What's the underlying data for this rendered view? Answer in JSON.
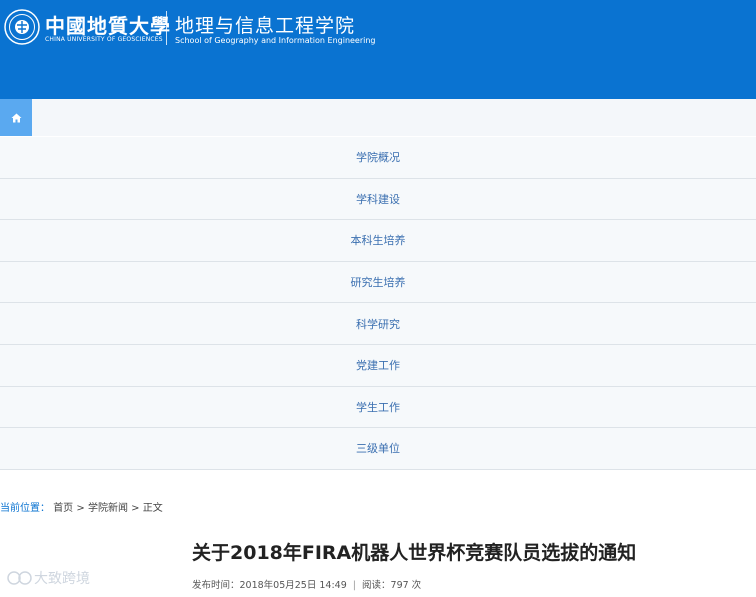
{
  "header": {
    "university_cn": "中國地質大學",
    "university_en": "CHINA UNIVERSITY OF GEOSCIENCES",
    "school_cn": "地理与信息工程学院",
    "school_en": "School of Geography and Information Engineering",
    "bg_color": "#0a73d1"
  },
  "home": {
    "icon": "home-icon"
  },
  "nav": {
    "items": [
      {
        "label": "学院概况"
      },
      {
        "label": "学科建设"
      },
      {
        "label": "本科生培养"
      },
      {
        "label": "研究生培养"
      },
      {
        "label": "科学研究"
      },
      {
        "label": "党建工作"
      },
      {
        "label": "学生工作"
      },
      {
        "label": "三级单位"
      }
    ]
  },
  "breadcrumb": {
    "prefix": "当前位置：",
    "items": [
      "首页",
      "学院新闻",
      "正文"
    ],
    "sep": ">"
  },
  "article": {
    "title": "关于2018年FIRA机器人世界杯竞赛队员选拔的通知",
    "date_label": "发布时间：2018年05月25日 14:49",
    "views_label": "阅读：797 次"
  },
  "watermark": {
    "text": "大致跨境"
  }
}
